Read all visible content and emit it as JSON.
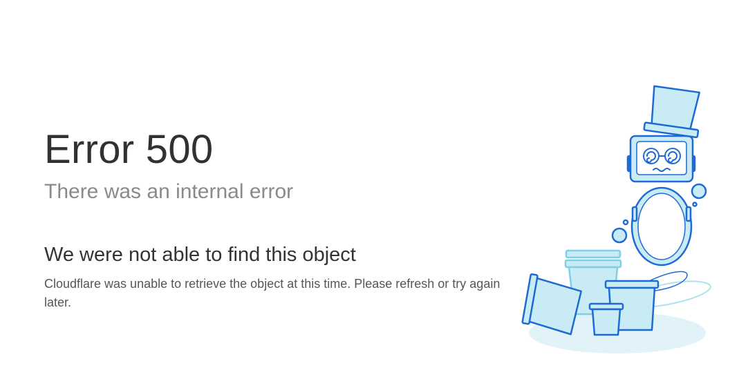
{
  "error": {
    "title": "Error 500",
    "subtitle": "There was an internal error",
    "heading": "We were not able to find this object",
    "message": "Cloudflare was unable to retrieve the object at this time. Please refresh or try again later."
  },
  "illustration": {
    "name": "confused-robot-with-buckets",
    "colors": {
      "stroke": "#1d6ad6",
      "fill": "#c9ebf5",
      "shadow": "#e1f3f9",
      "face": "#ffffff"
    }
  }
}
